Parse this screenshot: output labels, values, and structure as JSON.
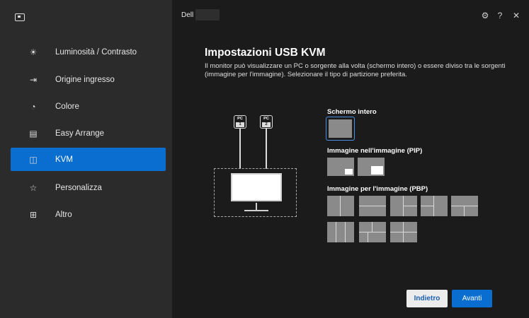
{
  "titlebar": {
    "app_name": "Dell"
  },
  "sidebar": {
    "items": [
      {
        "label": "Luminosità / Contrasto",
        "icon": "brightness-icon"
      },
      {
        "label": "Origine ingresso",
        "icon": "input-source-icon"
      },
      {
        "label": "Colore",
        "icon": "color-icon"
      },
      {
        "label": "Easy Arrange",
        "icon": "easy-arrange-icon"
      },
      {
        "label": "KVM",
        "icon": "kvm-icon",
        "active": true
      },
      {
        "label": "Personalizza",
        "icon": "star-icon"
      },
      {
        "label": "Altro",
        "icon": "others-icon"
      }
    ]
  },
  "main": {
    "title": "Impostazioni USB KVM",
    "description": "Il monitor può visualizzare un PC o sorgente alla volta (schermo intero) o essere diviso tra le sorgenti (immagine per l'immagine). Selezionare il tipo di partizione preferita.",
    "pc1": {
      "label": "PC",
      "number": "1"
    },
    "pc2": {
      "label": "PC",
      "number": "2"
    },
    "sections": {
      "fullscreen": "Schermo intero",
      "pip": "Immagine nell'immagine (PIP)",
      "pbp": "Immagine per l'immagine (PBP)"
    },
    "buttons": {
      "back": "Indietro",
      "next": "Avanti"
    }
  },
  "colors": {
    "accent": "#0a6ed1",
    "sidebar_bg": "#2b2b2b",
    "main_bg": "#1b1b1b",
    "layout_tile": "#8a8a8a"
  }
}
